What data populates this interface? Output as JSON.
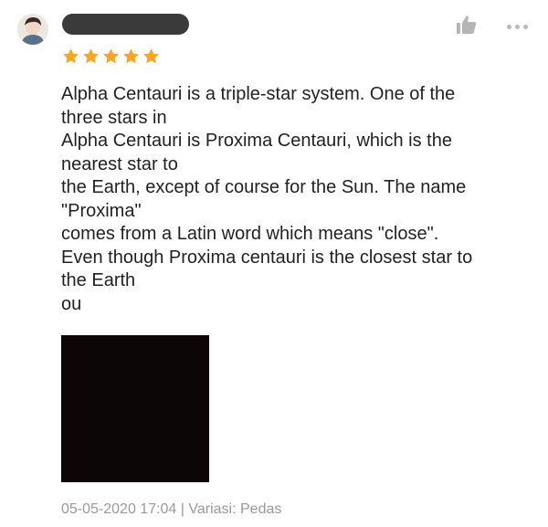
{
  "review": {
    "rating": 5,
    "rating_max": 5,
    "text_lines": [
      "Alpha Centauri is a triple-star system. One of the",
      "three stars in",
      "Alpha Centauri is Proxima Centauri, which is the",
      "nearest star to",
      "the Earth, except of course for the Sun. The name",
      "\"Proxima\"",
      "comes from a Latin word which means \"close\".",
      "Even though Proxima centauri is the closest star to",
      "the Earth",
      "ou"
    ],
    "date": "05-05-2020 17:04",
    "separator": "|",
    "variant": "Variasi: Pedas"
  },
  "colors": {
    "star": "#f5a623",
    "meta_text": "#9a9a9a",
    "redaction": "#3a3a3a"
  },
  "icons": {
    "like": "thumbs-up-icon",
    "more": "more-horizontal-icon"
  }
}
